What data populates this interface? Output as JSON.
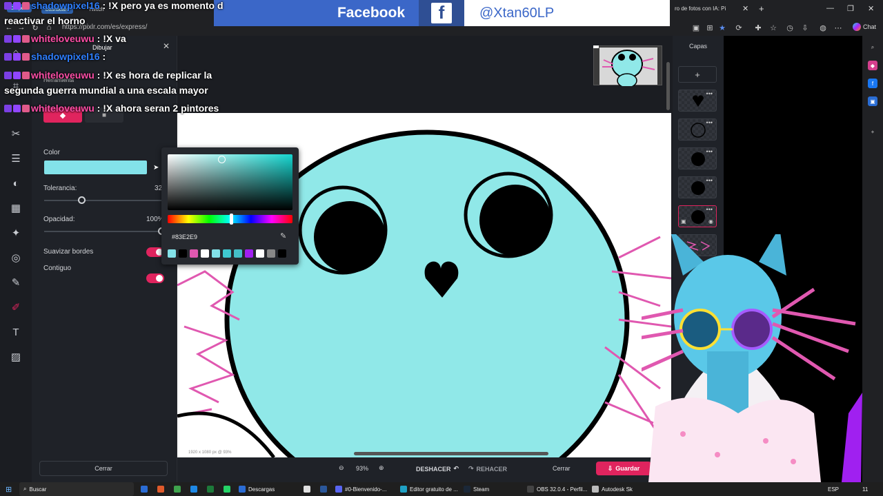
{
  "browser": {
    "url": "https://pixlr.com/es/express/",
    "tab_title": "ro de fotos con IA: Pi",
    "profile_label": "Chat",
    "tab_groups": [
      "Grupo 5",
      "Dashboard"
    ],
    "twitch_tab": "Twitch"
  },
  "social": {
    "facebook_label": "Facebook",
    "facebook_glyph": "f",
    "handle": "@Xtan60LP"
  },
  "panel": {
    "header": "Dibujar",
    "tool_label": "Herramienta",
    "color_label": "Color",
    "color_value": "#83E2E9",
    "tolerance_label": "Tolerancia:",
    "tolerance_value": "32",
    "opacity_label": "Opacidad:",
    "opacity_value": "100%",
    "smooth_label": "Suavizar bordes",
    "contiguous_label": "Contiguo",
    "close_label": "Cerrar",
    "tolerance_fraction": 0.32,
    "opacity_fraction": 1.0
  },
  "color_picker": {
    "hex": "#83E2E9",
    "swatches": [
      "#83e2e9",
      "#000000",
      "#e058b0",
      "#ffffff",
      "#83e2e9",
      "#3fc8cf",
      "#44c0c8",
      "#a020f0",
      "#ffffff",
      "#888888",
      "#000000"
    ]
  },
  "canvas": {
    "size_info": "1920 x 1080 px @ 93%",
    "fill_color": "#90e8e8"
  },
  "bottom": {
    "zoom": "93%",
    "undo": "DESHACER",
    "redo": "REHACER",
    "close": "Cerrar",
    "save": "Guardar"
  },
  "layers": {
    "title": "Capas",
    "add": "+"
  },
  "chat": [
    {
      "user": "shadowpixel16",
      "sep": " : ",
      "text": "!X pero ya es momento d",
      "color": "s"
    },
    {
      "user": "",
      "sep": "",
      "text": "reactivar el horno",
      "color": ""
    },
    {
      "user": "whiteloveuwu",
      "sep": " : ",
      "text": "!X va",
      "color": "w"
    },
    {
      "user": "shadowpixel16",
      "sep": " : ",
      "text": "",
      "color": "s"
    },
    {
      "user": "whiteloveuwu",
      "sep": " : ",
      "text": "!X es hora de replicar la",
      "color": "w"
    },
    {
      "user": "",
      "sep": "",
      "text": "segunda guerra mundial a una escala mayor",
      "color": ""
    },
    {
      "user": "whiteloveuwu",
      "sep": " : ",
      "text": "!X ahora seran 2 pintores",
      "color": "w"
    }
  ],
  "taskbar": {
    "search": "Buscar",
    "items": [
      "Descargas",
      "#0-Bienvenido-...",
      "Editor gratuito de ...",
      "Steam",
      "OBS 32.0.4 - Perfil...",
      "Autodesk Sk"
    ],
    "lang": "ESP",
    "clock": "11"
  },
  "colors": {
    "accent": "#e0245e",
    "panel_bg": "#1f2228",
    "workspace_bg": "#1b1d22",
    "facebook_blue": "#3b67c8"
  }
}
